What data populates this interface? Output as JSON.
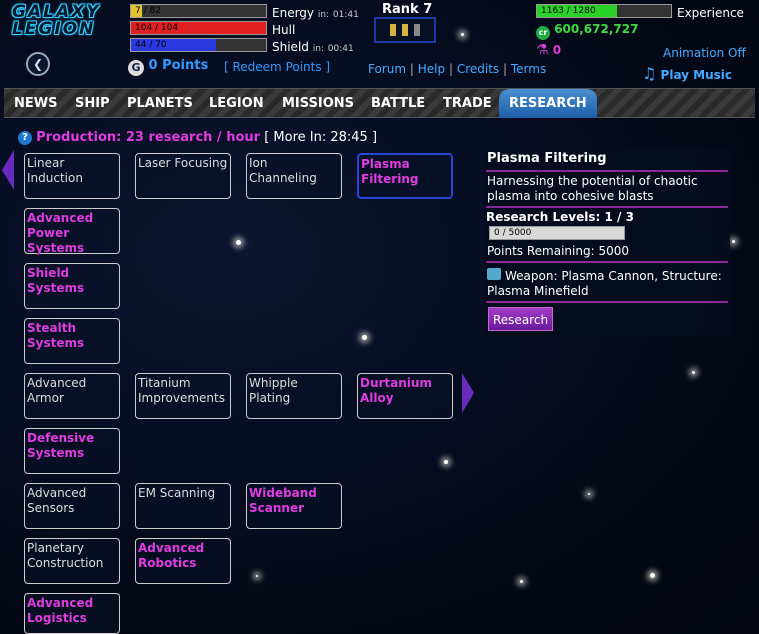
{
  "logo": {
    "line1": "GALAXY",
    "line2": "LEGION"
  },
  "stats": {
    "energy": {
      "value_text": "7 / 82",
      "fraction": 0.085,
      "label": "Energy",
      "timer_prefix": "in:",
      "timer": "01:41",
      "color": "#e3c42a"
    },
    "hull": {
      "value_text": "104 / 104",
      "fraction": 1.0,
      "label": "Hull",
      "color": "#e02020"
    },
    "shield": {
      "value_text": "44 / 70",
      "fraction": 0.63,
      "label": "Shield",
      "timer_prefix": "in:",
      "timer": "00:41",
      "color": "#2a3ae0"
    }
  },
  "points": {
    "icon_letter": "G",
    "text": "0 Points",
    "redeem": "[ Redeem Points ]"
  },
  "rank": {
    "title": "Rank 7"
  },
  "links": {
    "forum": "Forum",
    "help": "Help",
    "credits": "Credits",
    "terms": "Terms",
    "sep": "|"
  },
  "experience": {
    "value_text": "1163 / 1280",
    "fraction": 0.6,
    "label": "Experience"
  },
  "credits_amount": "600,672,727",
  "research_points": "0",
  "animation": "Animation Off",
  "music": "Play Music",
  "nav": [
    "NEWS",
    "SHIP",
    "PLANETS",
    "LEGION",
    "MISSIONS",
    "BATTLE",
    "TRADE",
    "RESEARCH"
  ],
  "production": {
    "main": "Production: 23 research / hour",
    "more": "[ More In: 28:45 ]"
  },
  "tiles": [
    {
      "label": "Linear Induction",
      "style": "white"
    },
    {
      "label": "Laser Focusing",
      "style": "white"
    },
    {
      "label": "Ion Channeling",
      "style": "white"
    },
    {
      "label": "Plasma Filtering",
      "style": "magenta"
    },
    {
      "label": "Advanced Power Systems",
      "style": "magenta"
    },
    {
      "label": "Shield Systems",
      "style": "magenta"
    },
    {
      "label": "Stealth Systems",
      "style": "magenta"
    },
    {
      "label": "Advanced Armor",
      "style": "white"
    },
    {
      "label": "Titanium Improvements",
      "style": "white"
    },
    {
      "label": "Whipple Plating",
      "style": "white"
    },
    {
      "label": "Durtanium Alloy",
      "style": "magenta"
    },
    {
      "label": "Defensive Systems",
      "style": "magenta"
    },
    {
      "label": "Advanced Sensors",
      "style": "white"
    },
    {
      "label": "EM Scanning",
      "style": "white"
    },
    {
      "label": "Wideband Scanner",
      "style": "magenta"
    },
    {
      "label": "Planetary Construction",
      "style": "white"
    },
    {
      "label": "Advanced Robotics",
      "style": "magenta"
    },
    {
      "label": "Advanced Logistics",
      "style": "magenta"
    }
  ],
  "panel": {
    "title": "Plasma Filtering",
    "description": "Harnessing the potential of chaotic plasma into cohesive blasts",
    "levels": "Research Levels: 1 / 3",
    "progress_text": "0 / 5000",
    "remaining": "Points Remaining: 5000",
    "unlocks": "Weapon: Plasma Cannon, Structure: Plasma Minefield",
    "button": "Research"
  }
}
